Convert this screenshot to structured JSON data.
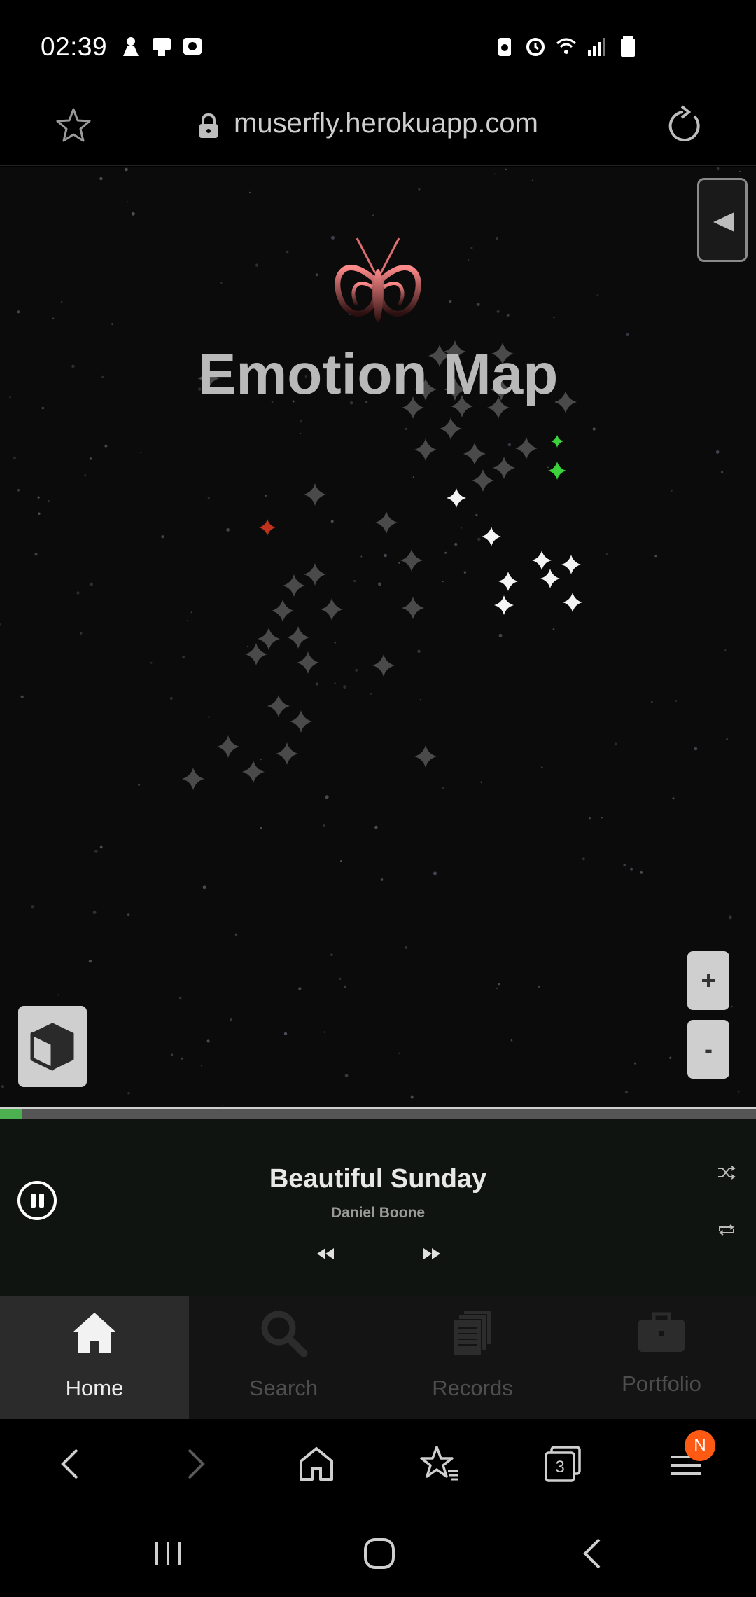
{
  "status_bar": {
    "time": "02:39"
  },
  "address_bar": {
    "url": "muserfly.herokuapp.com"
  },
  "map": {
    "title": "Emotion Map",
    "zoom_in_label": "+",
    "zoom_out_label": "-"
  },
  "player": {
    "progress": 0.03,
    "track_title": "Beautiful Sunday",
    "artist": "Daniel Boone"
  },
  "bottom_nav": {
    "items": [
      {
        "label": "Home",
        "icon": "home-icon",
        "active": true
      },
      {
        "label": "Search",
        "icon": "search-icon",
        "active": false
      },
      {
        "label": "Records",
        "icon": "records-icon",
        "active": false
      },
      {
        "label": "Portfolio",
        "icon": "briefcase-icon",
        "active": false
      }
    ]
  },
  "browser_toolbar": {
    "tabs_count": "3",
    "menu_badge": "N"
  },
  "colors": {
    "accent_green": "#4caf50",
    "logo_pink": "#e06060",
    "badge_orange": "#ff5a14"
  }
}
